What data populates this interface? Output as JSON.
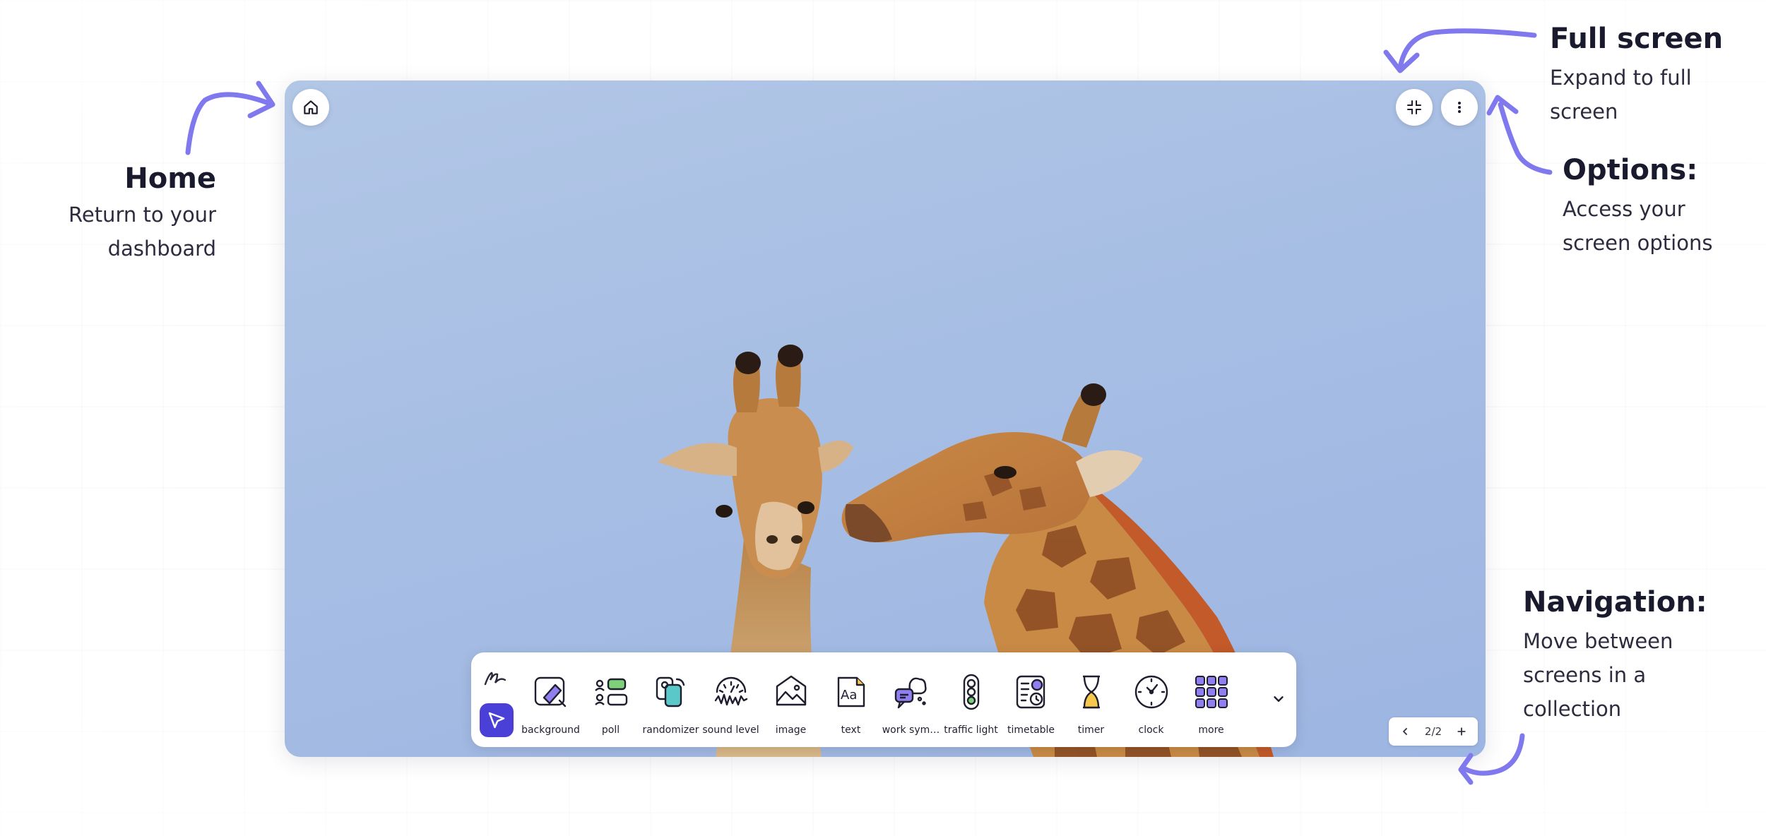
{
  "annotations": {
    "home": {
      "title": "Home",
      "line1": "Return to your",
      "line2": "dashboard"
    },
    "fullscreen": {
      "title": "Full screen",
      "line1": "Expand to full",
      "line2": "screen"
    },
    "options": {
      "title": "Options:",
      "line1": "Access your",
      "line2": "screen options"
    },
    "navigation": {
      "title": "Navigation:",
      "line1": "Move between",
      "line2": "screens in a",
      "line3": "collection"
    }
  },
  "screen": {
    "background": "giraffes photo on blue sky",
    "home_icon": "home-icon",
    "fullscreen_icon": "exit-fullscreen-icon",
    "options_icon": "more-vertical-icon"
  },
  "toolbar": {
    "pen_icon": "pen-scribble-icon",
    "select_icon": "pointer-icon",
    "widgets": [
      {
        "label": "background",
        "icon": "background-icon"
      },
      {
        "label": "poll",
        "icon": "poll-icon"
      },
      {
        "label": "randomizer",
        "icon": "randomizer-icon"
      },
      {
        "label": "sound level",
        "icon": "sound-level-icon"
      },
      {
        "label": "image",
        "icon": "image-icon"
      },
      {
        "label": "text",
        "icon": "text-icon"
      },
      {
        "label": "work sym…",
        "icon": "work-symbols-icon"
      },
      {
        "label": "traffic light",
        "icon": "traffic-light-icon"
      },
      {
        "label": "timetable",
        "icon": "timetable-icon"
      },
      {
        "label": "timer",
        "icon": "hourglass-icon"
      },
      {
        "label": "clock",
        "icon": "clock-icon"
      },
      {
        "label": "more",
        "icon": "grid-icon"
      }
    ],
    "collapse_icon": "chevron-down-icon"
  },
  "pager": {
    "page": "2/2",
    "prev_icon": "chevron-left-icon",
    "add_icon": "plus-icon"
  },
  "colors": {
    "accent": "#4a3fd6",
    "arrow": "#8079ee",
    "sky": "#a7bee4",
    "giraffe": "#c5823e"
  }
}
